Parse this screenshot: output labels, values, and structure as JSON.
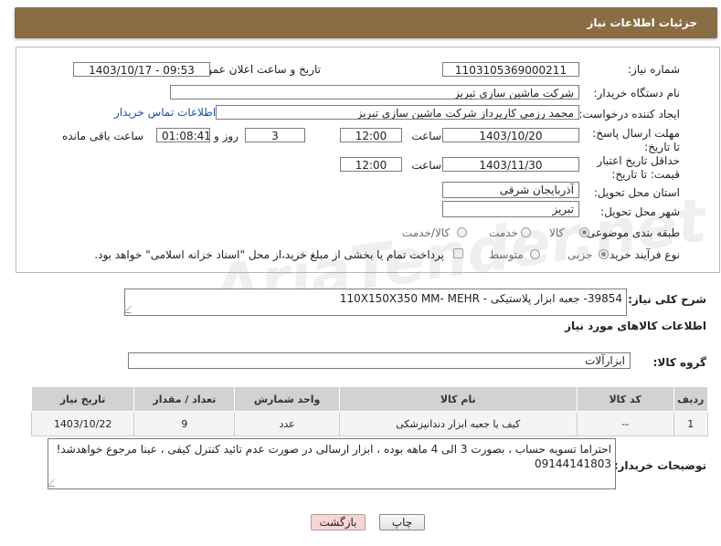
{
  "header": {
    "title": "جزئیات اطلاعات نیاز"
  },
  "watermark": {
    "text": "AriaTender.net"
  },
  "form": {
    "need_number_label": "شماره نیاز:",
    "need_number_value": "1103105369000211",
    "announce_label": "تاریخ و ساعت اعلان عمومی:",
    "announce_value": "1403/10/17 - 09:53",
    "buyer_label": "نام دستگاه خریدار:",
    "buyer_value": "شرکت ماشین سازی تبریز",
    "creator_label": "ایجاد کننده درخواست:",
    "creator_value": "محمد رزمی کارپرداز شرکت ماشین سازی تبریز",
    "contact_link": "اطلاعات تماس خریدار",
    "reply_deadline_label": "مهلت ارسال پاسخ: تا تاریخ:",
    "reply_date": "1403/10/20",
    "time_label": "ساعت",
    "reply_time": "12:00",
    "days_value": "3",
    "days_label": "روز و",
    "remaining_time": "01:08:41",
    "remaining_label": "ساعت باقی مانده",
    "price_deadline_label": "حداقل تاریخ اعتبار قیمت: تا تاریخ:",
    "price_date": "1403/11/30",
    "price_time": "12:00",
    "province_label": "استان محل تحویل:",
    "province_value": "آذربایجان شرقی",
    "city_label": "شهر محل تحویل:",
    "city_value": "تبریز",
    "category_label": "طبقه بندی موضوعی:",
    "category_options": [
      "کالا",
      "خدمت",
      "کالا/خدمت"
    ],
    "category_selected": "کالا",
    "process_label": "نوع فرآیند خرید :",
    "process_options": [
      "جزیی",
      "متوسط"
    ],
    "process_selected": "جزیی",
    "payment_text": "پرداخت تمام یا بخشی از مبلغ خرید،از محل \"اسناد خزانه اسلامی\" خواهد بود."
  },
  "description": {
    "label": "شرح کلی نیاز:",
    "value": "39854- جعبه ابزار پلاستیکی - 110X150X350 MM- MEHR"
  },
  "goods": {
    "section_title": "اطلاعات کالاهای مورد نیاز",
    "group_label": "گروه کالا:",
    "group_value": "ابزارآلات",
    "columns": [
      "ردیف",
      "کد کالا",
      "نام کالا",
      "واحد شمارش",
      "تعداد / مقدار",
      "تاریخ نیاز"
    ],
    "rows": [
      {
        "row": "1",
        "code": "--",
        "name": "کیف یا جعبه ابزار دندانپزشکی",
        "unit": "عدد",
        "qty": "9",
        "date": "1403/10/22"
      }
    ]
  },
  "buyer_notes": {
    "label": "توضیحات خریدار:",
    "line1": "احتراما تسویه حساب ، بصورت 3 الی 4 ماهه بوده ، ابزار ارسالی در صورت عدم تائید کنترل کیفی ، عینا مرجوع خواهدشد!",
    "line2": "09144141803"
  },
  "buttons": {
    "print": "چاپ",
    "back": "بازگشت"
  }
}
